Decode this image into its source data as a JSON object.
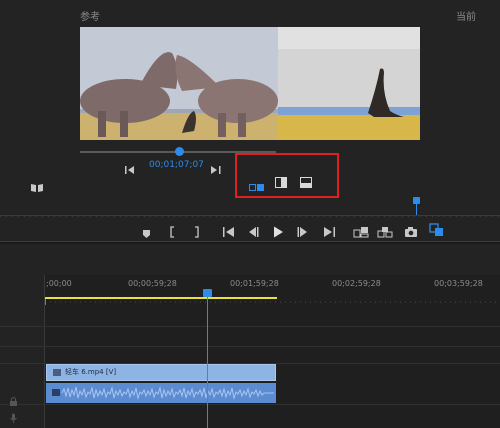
{
  "monitor": {
    "reference_label": "参考",
    "current_label": "当前",
    "timecode": "00;01;07;07"
  },
  "timeline": {
    "ruler_labels": [
      ";00;00",
      "00;00;59;28",
      "00;01;59;28",
      "00;02;59;28",
      "00;03;59;28"
    ]
  },
  "clip": {
    "label": "轻车 6.mp4 [V]"
  },
  "colors": {
    "accent": "#2d8ceb",
    "highlight_box": "#e0201b",
    "clip_video": "#8eb4e3",
    "clip_audio": "#5b8bd1",
    "work_area": "#e8e23a"
  }
}
